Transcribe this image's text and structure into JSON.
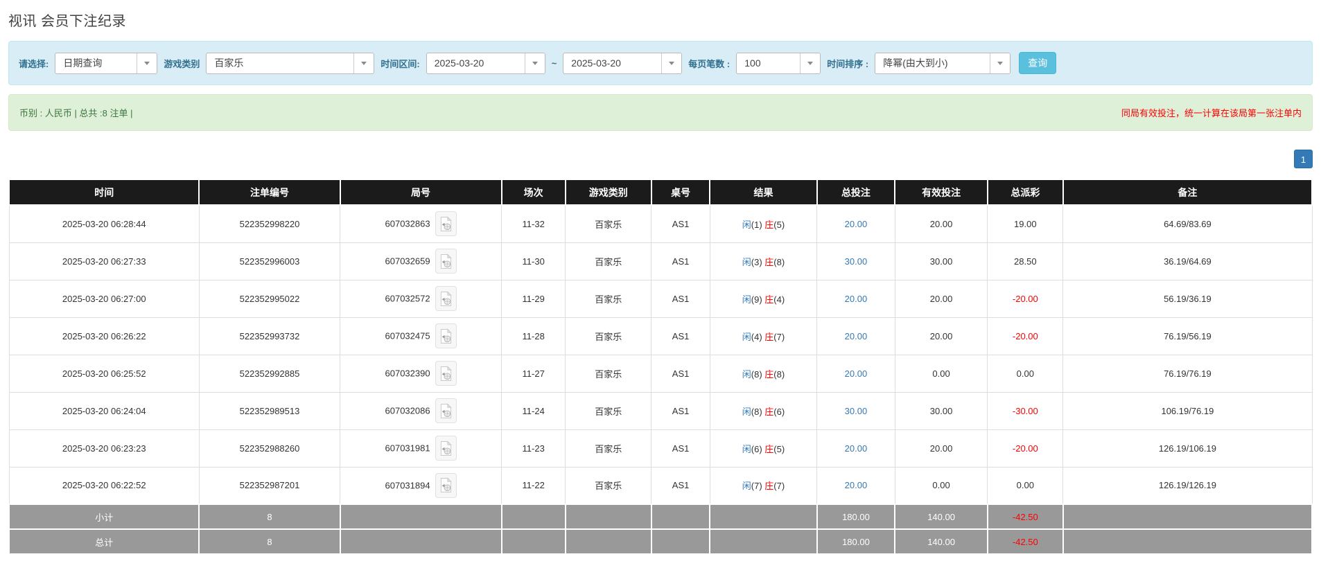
{
  "page": {
    "title": "视讯 会员下注纪录"
  },
  "filters": {
    "select_label": "请选择:",
    "select_value": "日期查询",
    "game_label": "游戏类别",
    "game_value": "百家乐",
    "range_label": "时间区间:",
    "date_from": "2025-03-20",
    "range_separator": "~",
    "date_to": "2025-03-20",
    "page_size_label": "每页笔数 :",
    "page_size_value": "100",
    "sort_label": "时间排序 :",
    "sort_value": "降幂(由大到小)",
    "search_label": "查询"
  },
  "summary": {
    "currency_info": "币别 : 人民币 | 总共 :8 注单 |",
    "notice": "同局有效投注，统一计算在该局第一张注单内"
  },
  "pagination": {
    "page": "1"
  },
  "colors": {
    "accent_blue": "#337ab7",
    "negative_red": "#ff0000",
    "header_bg": "#1b1b1b",
    "footer_bg": "#999999",
    "filter_panel_bg": "#d9edf7",
    "summary_bar_bg": "#dff0d8",
    "search_button_bg": "#5bc0de"
  },
  "table": {
    "headers": [
      "时间",
      "注单编号",
      "局号",
      "场次",
      "游戏类别",
      "桌号",
      "结果",
      "总投注",
      "有效投注",
      "总派彩",
      "备注"
    ],
    "rows": [
      {
        "time": "2025-03-20 06:28:44",
        "bet_id": "522352998220",
        "round_id": "607032863",
        "session": "11-32",
        "game": "百家乐",
        "table_no": "AS1",
        "result_p": "闲",
        "result_p_num": "(1)",
        "result_b": "庄",
        "result_b_num": "(5)",
        "total_bet": "20.00",
        "valid_bet": "20.00",
        "payout": "19.00",
        "remark": "64.69/83.69"
      },
      {
        "time": "2025-03-20 06:27:33",
        "bet_id": "522352996003",
        "round_id": "607032659",
        "session": "11-30",
        "game": "百家乐",
        "table_no": "AS1",
        "result_p": "闲",
        "result_p_num": "(3)",
        "result_b": "庄",
        "result_b_num": "(8)",
        "total_bet": "30.00",
        "valid_bet": "30.00",
        "payout": "28.50",
        "remark": "36.19/64.69"
      },
      {
        "time": "2025-03-20 06:27:00",
        "bet_id": "522352995022",
        "round_id": "607032572",
        "session": "11-29",
        "game": "百家乐",
        "table_no": "AS1",
        "result_p": "闲",
        "result_p_num": "(9)",
        "result_b": "庄",
        "result_b_num": "(4)",
        "total_bet": "20.00",
        "valid_bet": "20.00",
        "payout": "-20.00",
        "remark": "56.19/36.19"
      },
      {
        "time": "2025-03-20 06:26:22",
        "bet_id": "522352993732",
        "round_id": "607032475",
        "session": "11-28",
        "game": "百家乐",
        "table_no": "AS1",
        "result_p": "闲",
        "result_p_num": "(4)",
        "result_b": "庄",
        "result_b_num": "(7)",
        "total_bet": "20.00",
        "valid_bet": "20.00",
        "payout": "-20.00",
        "remark": "76.19/56.19"
      },
      {
        "time": "2025-03-20 06:25:52",
        "bet_id": "522352992885",
        "round_id": "607032390",
        "session": "11-27",
        "game": "百家乐",
        "table_no": "AS1",
        "result_p": "闲",
        "result_p_num": "(8)",
        "result_b": "庄",
        "result_b_num": "(8)",
        "total_bet": "20.00",
        "valid_bet": "0.00",
        "payout": "0.00",
        "remark": "76.19/76.19"
      },
      {
        "time": "2025-03-20 06:24:04",
        "bet_id": "522352989513",
        "round_id": "607032086",
        "session": "11-24",
        "game": "百家乐",
        "table_no": "AS1",
        "result_p": "闲",
        "result_p_num": "(8)",
        "result_b": "庄",
        "result_b_num": "(6)",
        "total_bet": "30.00",
        "valid_bet": "30.00",
        "payout": "-30.00",
        "remark": "106.19/76.19"
      },
      {
        "time": "2025-03-20 06:23:23",
        "bet_id": "522352988260",
        "round_id": "607031981",
        "session": "11-23",
        "game": "百家乐",
        "table_no": "AS1",
        "result_p": "闲",
        "result_p_num": "(6)",
        "result_b": "庄",
        "result_b_num": "(5)",
        "total_bet": "20.00",
        "valid_bet": "20.00",
        "payout": "-20.00",
        "remark": "126.19/106.19"
      },
      {
        "time": "2025-03-20 06:22:52",
        "bet_id": "522352987201",
        "round_id": "607031894",
        "session": "11-22",
        "game": "百家乐",
        "table_no": "AS1",
        "result_p": "闲",
        "result_p_num": "(7)",
        "result_b": "庄",
        "result_b_num": "(7)",
        "total_bet": "20.00",
        "valid_bet": "0.00",
        "payout": "0.00",
        "remark": "126.19/126.19"
      }
    ],
    "footer": [
      {
        "label": "小计",
        "count": "8",
        "total_bet": "180.00",
        "valid_bet": "140.00",
        "payout": "-42.50"
      },
      {
        "label": "总计",
        "count": "8",
        "total_bet": "180.00",
        "valid_bet": "140.00",
        "payout": "-42.50"
      }
    ]
  }
}
